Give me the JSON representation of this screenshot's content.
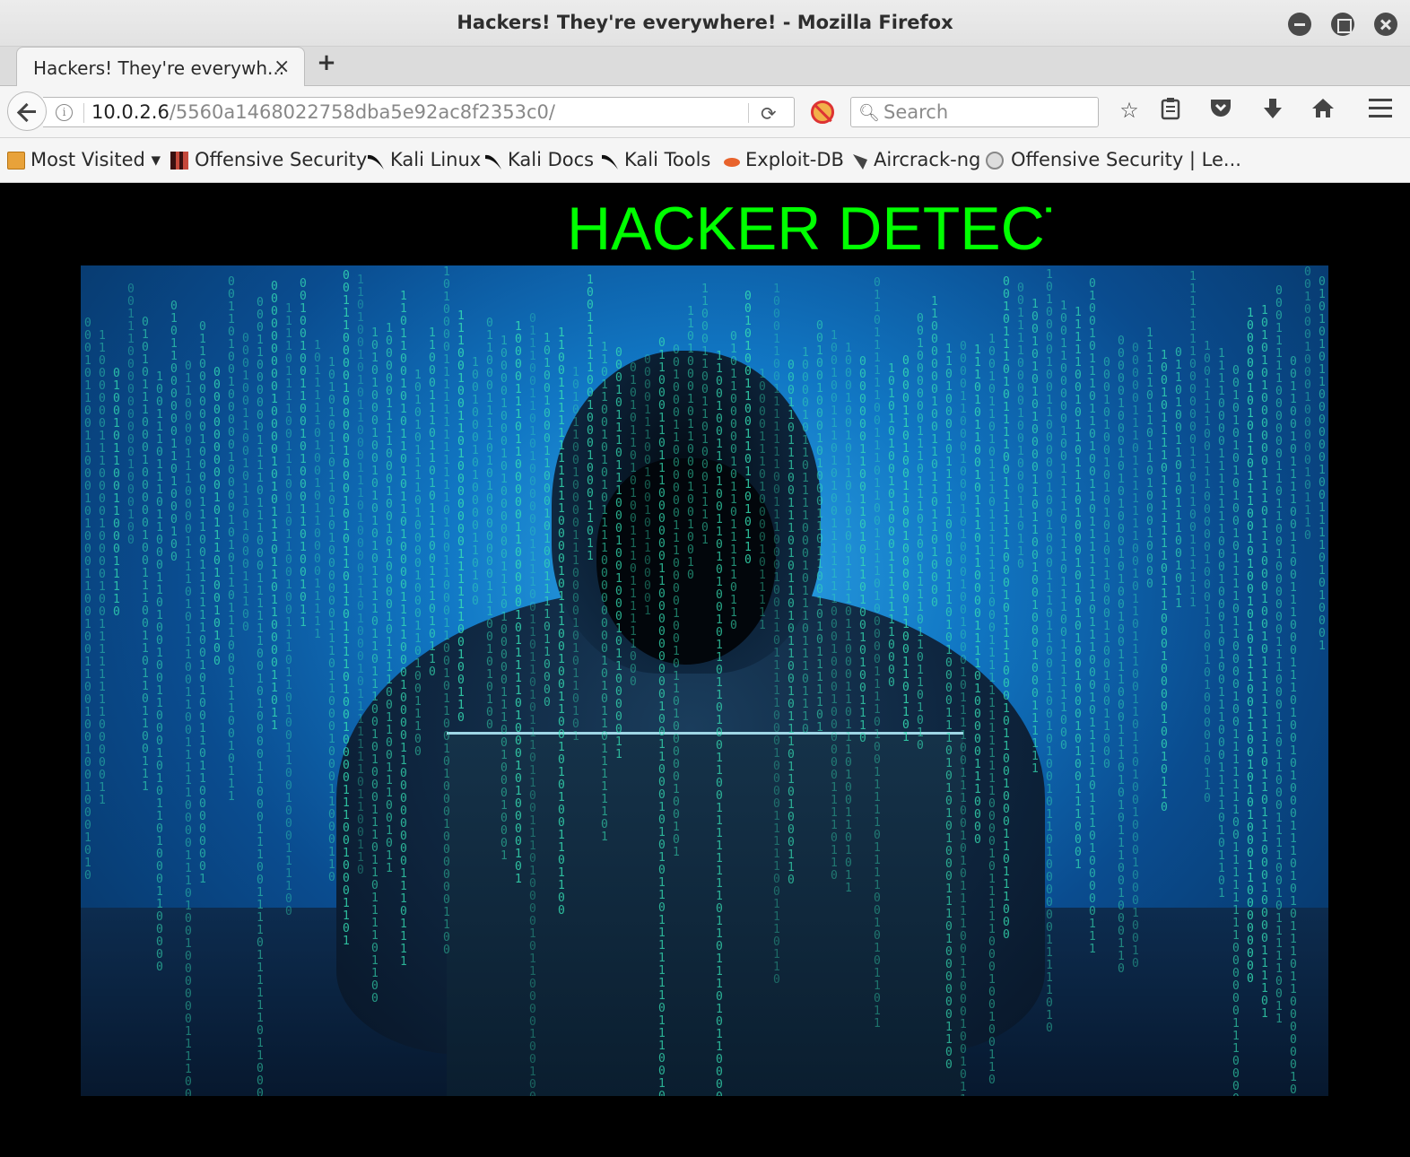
{
  "window": {
    "title": "Hackers! They're everywhere! - Mozilla Firefox"
  },
  "tabs": [
    {
      "label": "Hackers! They're everywh..."
    }
  ],
  "navbar": {
    "url_host": "10.0.2.6",
    "url_path": "/5560a1468022758dba5e92ac8f2353c0/",
    "search_placeholder": "Search"
  },
  "bookmarks": [
    {
      "label": "Most Visited ▾",
      "icon": "folder-icon"
    },
    {
      "label": "Offensive Security",
      "icon": "offsec-icon"
    },
    {
      "label": "Kali Linux",
      "icon": "kali-icon"
    },
    {
      "label": "Kali Docs",
      "icon": "kali-icon"
    },
    {
      "label": "Kali Tools",
      "icon": "kali-icon"
    },
    {
      "label": "Exploit-DB",
      "icon": "exploitdb-icon"
    },
    {
      "label": "Aircrack-ng",
      "icon": "aircrack-icon"
    },
    {
      "label": "Offensive Security | Le...",
      "icon": "globe-icon"
    }
  ],
  "page": {
    "marquee_text": "HACKER DETECTED",
    "marquee_color": "#00ff00",
    "background": "#000000"
  }
}
